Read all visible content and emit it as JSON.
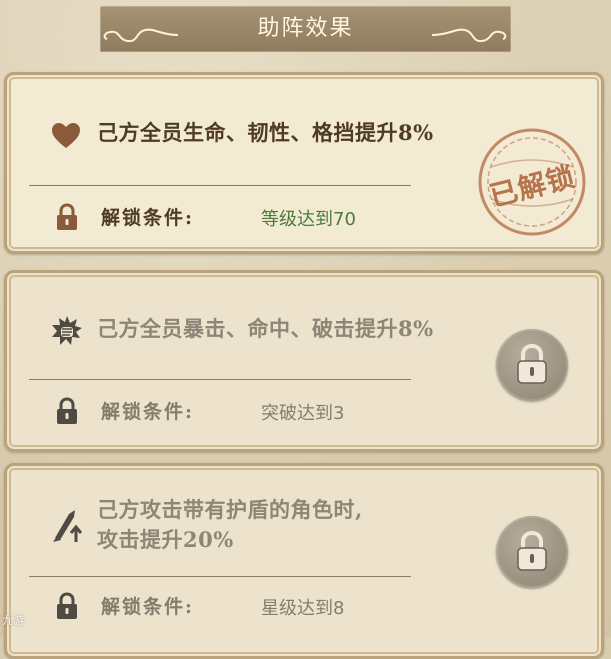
{
  "header": {
    "title": "助阵效果"
  },
  "cards": [
    {
      "status": "unlocked",
      "icon": "heart-icon",
      "effect_lines": [
        "己方全员生命、韧性、格挡提升8%"
      ],
      "condition_label": "解锁条件:",
      "condition_value": "等级达到70",
      "stamp_text": "已解锁"
    },
    {
      "status": "locked",
      "icon": "fist-burst-icon",
      "effect_lines": [
        "己方全员暴击、命中、破击提升8%"
      ],
      "condition_label": "解锁条件:",
      "condition_value": "突破达到3"
    },
    {
      "status": "locked",
      "icon": "sword-up-icon",
      "effect_lines": [
        "己方攻击带有护盾的角色时,",
        "攻击提升20%"
      ],
      "condition_label": "解锁条件:",
      "condition_value": "星级达到8"
    }
  ],
  "watermark": "九游",
  "colors": {
    "header_bar": "#978467",
    "card_bg": "#f3ead3",
    "card_border": "#b9a27c",
    "unlocked_value": "#4a7a3c",
    "stamp": "#b0683f"
  }
}
